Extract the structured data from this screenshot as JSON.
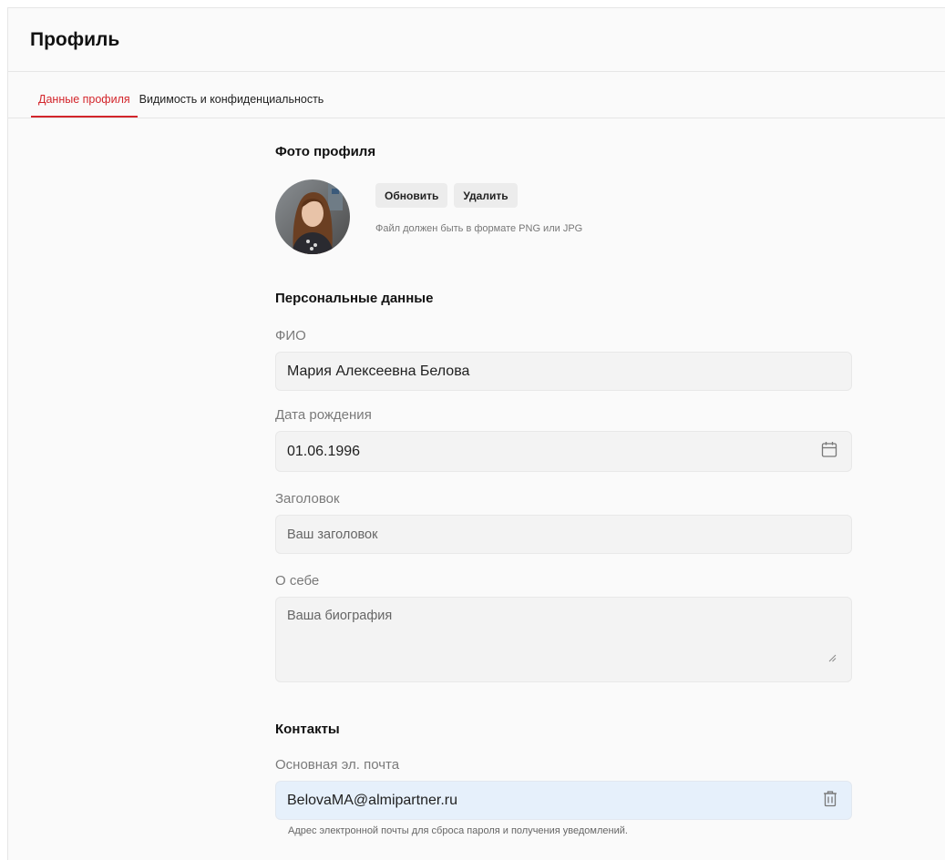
{
  "header": {
    "title": "Профиль"
  },
  "tabs": [
    {
      "label": "Данные профиля",
      "active": true
    },
    {
      "label": "Видимость и конфиденциальность",
      "active": false
    }
  ],
  "photo": {
    "section_title": "Фото профиля",
    "update_label": "Обновить",
    "delete_label": "Удалить",
    "hint": "Файл должен быть в формате PNG или JPG"
  },
  "personal": {
    "section_title": "Персональные данные",
    "fio_label": "ФИО",
    "fio_value": "Мария Алексеевна Белова",
    "birth_label": "Дата рождения",
    "birth_value": "01.06.1996",
    "headline_label": "Заголовок",
    "headline_placeholder": "Ваш заголовок",
    "about_label": "О себе",
    "about_placeholder": "Ваша биография"
  },
  "contacts": {
    "section_title": "Контакты",
    "email_label": "Основная эл. почта",
    "email_value": "BelovaMA@almipartner.ru",
    "email_hint": "Адрес электронной почты для сброса пароля и получения уведомлений."
  },
  "colors": {
    "accent": "#d3252b",
    "field_bg": "#f3f3f3",
    "email_bg": "#e6f0fb"
  },
  "icons": [
    "calendar-icon",
    "trash-icon",
    "resize-handle-icon"
  ]
}
